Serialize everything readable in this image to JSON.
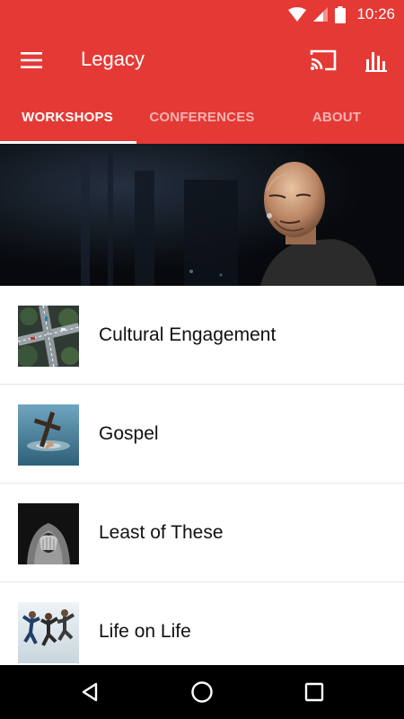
{
  "status": {
    "time": "10:26"
  },
  "app": {
    "title": "Legacy"
  },
  "tabs": [
    {
      "label": "WORKSHOPS",
      "active": true
    },
    {
      "label": "CONFERENCES",
      "active": false
    },
    {
      "label": "ABOUT",
      "active": false
    }
  ],
  "list": [
    {
      "label": "Cultural Engagement",
      "thumb": "aerial-intersection-image"
    },
    {
      "label": "Gospel",
      "thumb": "cross-in-water-image"
    },
    {
      "label": "Least of These",
      "thumb": "hooded-person-image"
    },
    {
      "label": "Life on Life",
      "thumb": "friends-jumping-image"
    }
  ],
  "colors": {
    "primary": "#e53935",
    "navbar": "#000000"
  }
}
